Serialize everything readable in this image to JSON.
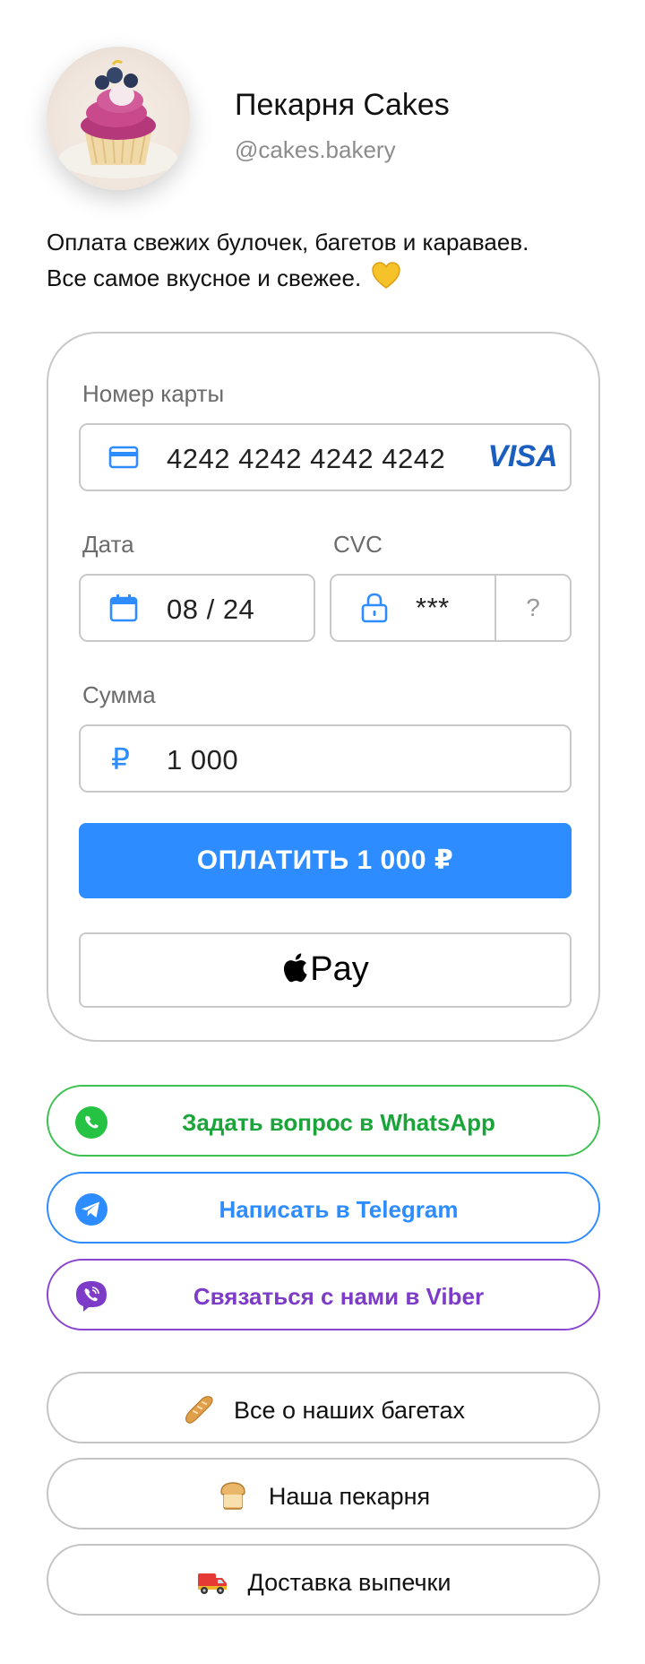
{
  "profile": {
    "name": "Пекарня Cakes",
    "handle": "@cakes.bakery",
    "description_line1": "Оплата свежих булочек, багетов и караваев.",
    "description_line2": "Все самое вкусное и свежее."
  },
  "payment_form": {
    "card_label": "Номер карты",
    "card_number": "4242 4242 4242 4242",
    "card_brand": "VISA",
    "date_label": "Дата",
    "date_value": "08 / 24",
    "cvc_label": "CVC",
    "cvc_value": "***",
    "cvc_help": "?",
    "amount_label": "Сумма",
    "currency_symbol": "₽",
    "amount_value": "1 000",
    "pay_button_label": "ОПЛАТИТЬ 1 000 ₽",
    "applepay_label": "Pay"
  },
  "messengers": [
    {
      "label": "Задать вопрос в WhatsApp",
      "color": "#1aa43a",
      "border": "#3ec152",
      "icon": "whatsapp-icon"
    },
    {
      "label": "Написать в Telegram",
      "color": "#2d8cff",
      "border": "#2d8cff",
      "icon": "telegram-icon"
    },
    {
      "label": "Связаться с нами в Viber",
      "color": "#7d3cc8",
      "border": "#8a45d1",
      "icon": "viber-icon"
    }
  ],
  "links": [
    {
      "label": "Все о наших багетах",
      "icon": "baguette-icon"
    },
    {
      "label": "Наша пекарня",
      "icon": "bread-icon"
    },
    {
      "label": "Доставка выпечки",
      "icon": "delivery-truck-icon"
    }
  ],
  "colors": {
    "accent": "#2d8cff",
    "border": "#c9c9c9",
    "visa": "#1a5fbf"
  }
}
